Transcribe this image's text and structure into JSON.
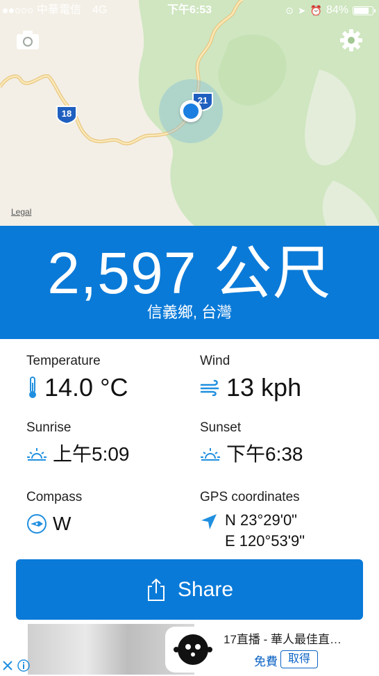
{
  "status_bar": {
    "carrier": "中華電信",
    "network": "4G",
    "time": "下午6:53",
    "battery": "84%",
    "battery_level": 0.84
  },
  "map": {
    "legal_label": "Legal",
    "route_shields": [
      "18",
      "21"
    ]
  },
  "header": {
    "altitude": "2,597 公尺",
    "location": "信義鄉, 台灣"
  },
  "info": {
    "temperature": {
      "label": "Temperature",
      "value": "14.0 °C"
    },
    "wind": {
      "label": "Wind",
      "value": "13 kph"
    },
    "sunrise": {
      "label": "Sunrise",
      "value": "上午5:09"
    },
    "sunset": {
      "label": "Sunset",
      "value": "下午6:38"
    },
    "compass": {
      "label": "Compass",
      "value": "W"
    },
    "gps": {
      "label": "GPS coordinates",
      "lat": "N 23°29'0\"",
      "lon": "E 120°53'9\""
    }
  },
  "share_button": {
    "label": "Share"
  },
  "ad": {
    "title": "17直播 - 華人最佳直…",
    "free": "免費",
    "get": "取得"
  },
  "colors": {
    "accent": "#0a7ad8",
    "icon_blue": "#1f8fe0"
  }
}
